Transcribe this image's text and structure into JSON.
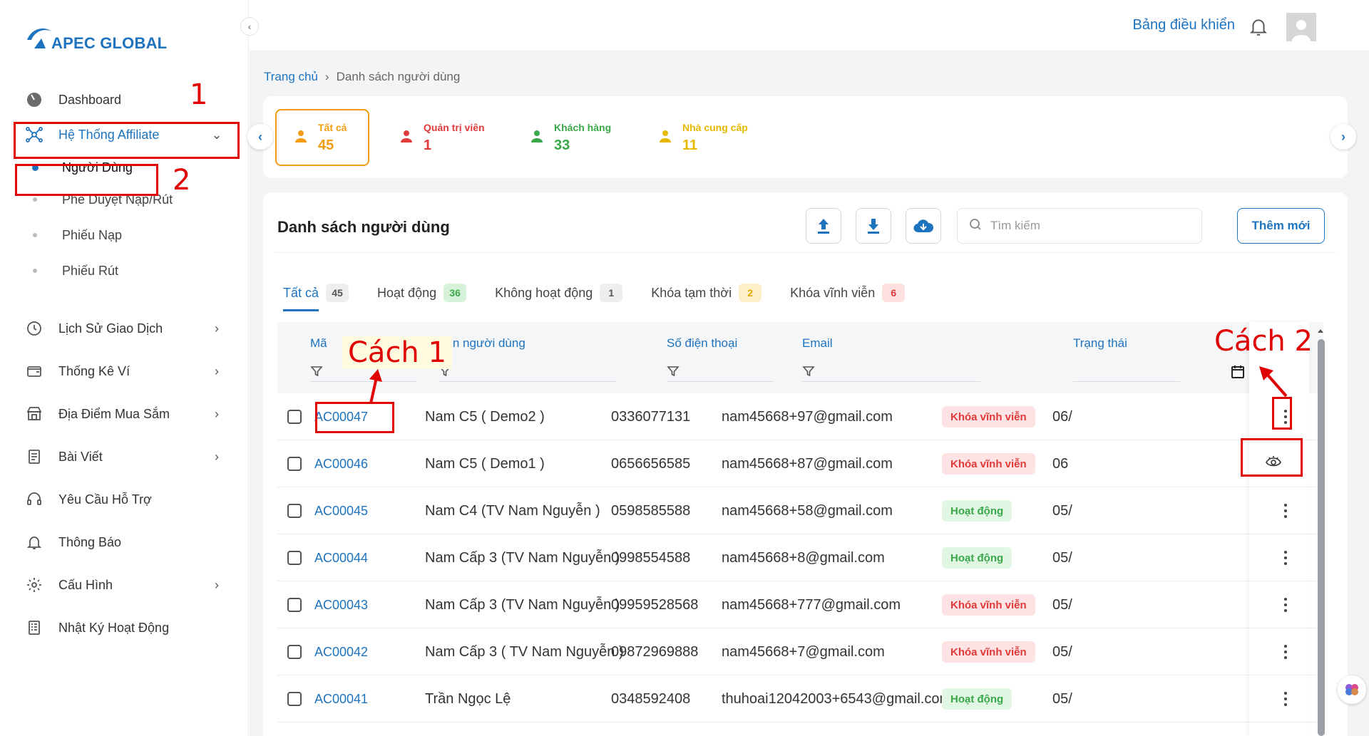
{
  "brand": {
    "name": "APEC GLOBAL"
  },
  "sidebar": {
    "items": [
      {
        "label": "Dashboard",
        "icon": "gauge-icon"
      },
      {
        "label": "Hệ Thống Affiliate",
        "icon": "network-icon"
      },
      {
        "label": "Lịch Sử Giao Dịch",
        "icon": "clock-icon"
      },
      {
        "label": "Thống Kê Ví",
        "icon": "wallet-icon"
      },
      {
        "label": "Địa Điểm Mua Sắm",
        "icon": "store-icon"
      },
      {
        "label": "Bài Viết",
        "icon": "article-icon"
      },
      {
        "label": "Yêu Cầu Hỗ Trợ",
        "icon": "headset-icon"
      },
      {
        "label": "Thông Báo",
        "icon": "bell-icon"
      },
      {
        "label": "Cấu Hình",
        "icon": "gear-icon"
      },
      {
        "label": "Nhật Ký Hoạt Động",
        "icon": "log-icon"
      }
    ],
    "sub_items": [
      {
        "label": "Người Dùng"
      },
      {
        "label": "Phê Duyệt Nạp/Rút"
      },
      {
        "label": "Phiếu Nạp"
      },
      {
        "label": "Phiếu Rút"
      }
    ]
  },
  "header": {
    "dashboard_link": "Bảng điều khiển"
  },
  "breadcrumb": {
    "home": "Trang chủ",
    "current": "Danh sách người dùng"
  },
  "stats": [
    {
      "title": "Tất cả",
      "value": "45",
      "bg": "#fde4c8",
      "color": "#f39c12"
    },
    {
      "title": "Quản trị viên",
      "value": "1",
      "bg": "#f6caca",
      "color": "#e03a3a"
    },
    {
      "title": "Khách hàng",
      "value": "33",
      "bg": "#cdeccd",
      "color": "#3aa84a"
    },
    {
      "title": "Nhà cung cấp",
      "value": "11",
      "bg": "#f8edc6",
      "color": "#e6b800"
    }
  ],
  "list": {
    "title": "Danh sách người dùng",
    "search_placeholder": "Tìm kiếm",
    "add_label": "Thêm mới"
  },
  "tabs": [
    {
      "label": "Tất cả",
      "count": "45",
      "badge_bg": "#eeeeee",
      "badge_color": "#555555"
    },
    {
      "label": "Hoạt động",
      "count": "36",
      "badge_bg": "#d6f2d8",
      "badge_color": "#3aa84a"
    },
    {
      "label": "Không hoạt động",
      "count": "1",
      "badge_bg": "#eeeeee",
      "badge_color": "#555555"
    },
    {
      "label": "Khóa tạm thời",
      "count": "2",
      "badge_bg": "#fdefc8",
      "badge_color": "#e6a700"
    },
    {
      "label": "Khóa vĩnh viễn",
      "count": "6",
      "badge_bg": "#fde0e0",
      "badge_color": "#e03a3a"
    }
  ],
  "columns": {
    "code": "Mã",
    "name": "Tên người dùng",
    "phone": "Số điện thoại",
    "email": "Email",
    "status": "Trạng thái"
  },
  "rows": [
    {
      "code": "AC00047",
      "name": "Nam C5 ( Demo2 )",
      "phone": "0336077131",
      "email": "nam45668+97@gmail.com",
      "status": "Khóa vĩnh viễn",
      "status_type": "lock",
      "date": "06/"
    },
    {
      "code": "AC00046",
      "name": "Nam C5 ( Demo1 )",
      "phone": "0656656585",
      "email": "nam45668+87@gmail.com",
      "status": "Khóa vĩnh viễn",
      "status_type": "lock",
      "date": "06"
    },
    {
      "code": "AC00045",
      "name": "Nam C4 (TV Nam Nguyễn )",
      "phone": "0598585588",
      "email": "nam45668+58@gmail.com",
      "status": "Hoạt động",
      "status_type": "active",
      "date": "05/"
    },
    {
      "code": "AC00044",
      "name": "Nam Cấp 3 (TV Nam Nguyễn )",
      "phone": "0998554588",
      "email": "nam45668+8@gmail.com",
      "status": "Hoạt động",
      "status_type": "active",
      "date": "05/"
    },
    {
      "code": "AC00043",
      "name": "Nam Cấp 3 (TV Nam Nguyễn )",
      "phone": "09959528568",
      "email": "nam45668+777@gmail.com",
      "status": "Khóa vĩnh viễn",
      "status_type": "lock",
      "date": "05/"
    },
    {
      "code": "AC00042",
      "name": "Nam Cấp 3 ( TV Nam Nguyễn )",
      "phone": "09872969888",
      "email": "nam45668+7@gmail.com",
      "status": "Khóa vĩnh viễn",
      "status_type": "lock",
      "date": "05/"
    },
    {
      "code": "AC00041",
      "name": "Trần Ngọc Lệ",
      "phone": "0348592408",
      "email": "thuhoai12042003+6543@gmail.com",
      "status": "Hoạt động",
      "status_type": "active",
      "date": "05/"
    }
  ],
  "annotations": {
    "num1": "1",
    "num2": "2",
    "way1": "Cách 1",
    "way2": "Cách 2"
  },
  "accent": "#1e73be",
  "annotation_color": "#e00000"
}
